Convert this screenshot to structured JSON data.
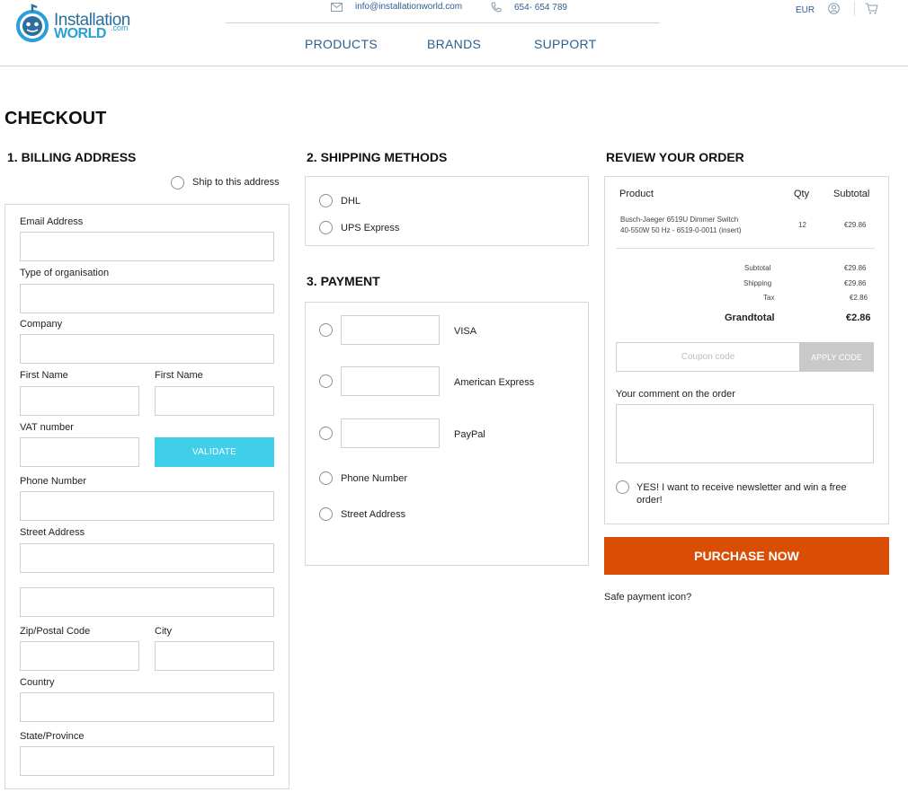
{
  "header": {
    "logo": {
      "line1": "Installation",
      "line2": "WORLD",
      "suffix": ".com"
    },
    "email": "info@installationworld.com",
    "phone": "654- 654 789",
    "currency": "EUR",
    "nav": [
      "PRODUCTS",
      "BRANDS",
      "SUPPORT"
    ],
    "colors": {
      "link": "#2c5f8e",
      "logo_blue": "#2b9fd8"
    }
  },
  "page": {
    "title": "CHECKOUT"
  },
  "billing": {
    "title": "1. BILLING ADDRESS",
    "ship_to_this_address": "Ship to this address",
    "email_label": "Email Address",
    "org_label": "Type of organisation",
    "company_label": "Company",
    "first_name_label": "First Name",
    "first_name_label_2": "First Name",
    "vat_label": "VAT number",
    "validate_label": "VALIDATE",
    "phone_label": "Phone Number",
    "street_label": "Street Address",
    "zip_label": "Zip/Postal Code",
    "city_label": "City",
    "country_label": "Country",
    "state_label": "State/Province",
    "validate_color": "#3fcfea"
  },
  "shipping": {
    "title": "2. SHIPPING METHODS",
    "options": [
      "DHL",
      "UPS Express"
    ]
  },
  "payment": {
    "title": "3. PAYMENT",
    "card_options": [
      "VISA",
      "American Express",
      "PayPal"
    ],
    "other_options": [
      "Phone Number",
      "Street Address"
    ]
  },
  "review": {
    "title": "REVIEW YOUR ORDER",
    "col_product": "Product",
    "col_qty": "Qty",
    "col_subtotal": "Subtotal",
    "item": {
      "name_line1": "Busch-Jaeger 6519U Dimmer Switch",
      "name_line2": "40-550W 50 Hz - 6519-0-0011 (insert)",
      "qty": "12",
      "subtotal": "€29.86"
    },
    "totals": {
      "subtotal_label": "Subtotal",
      "subtotal": "€29.86",
      "shipping_label": "Shipping",
      "shipping": "€29.86",
      "tax_label": "Tax",
      "tax": "€2.86",
      "grandtotal_label": "Grandtotal",
      "grandtotal": "€2.86"
    },
    "coupon_placeholder": "Coupon code",
    "apply_label": "APPLY CODE",
    "comment_label": "Your comment on the order",
    "newsletter_line1": "YES! I want to receive newsletter and win a free",
    "newsletter_line2": "order!",
    "purchase_label": "PURCHASE NOW",
    "safe_payment": "Safe payment icon?",
    "purchase_color": "#d94d05"
  }
}
